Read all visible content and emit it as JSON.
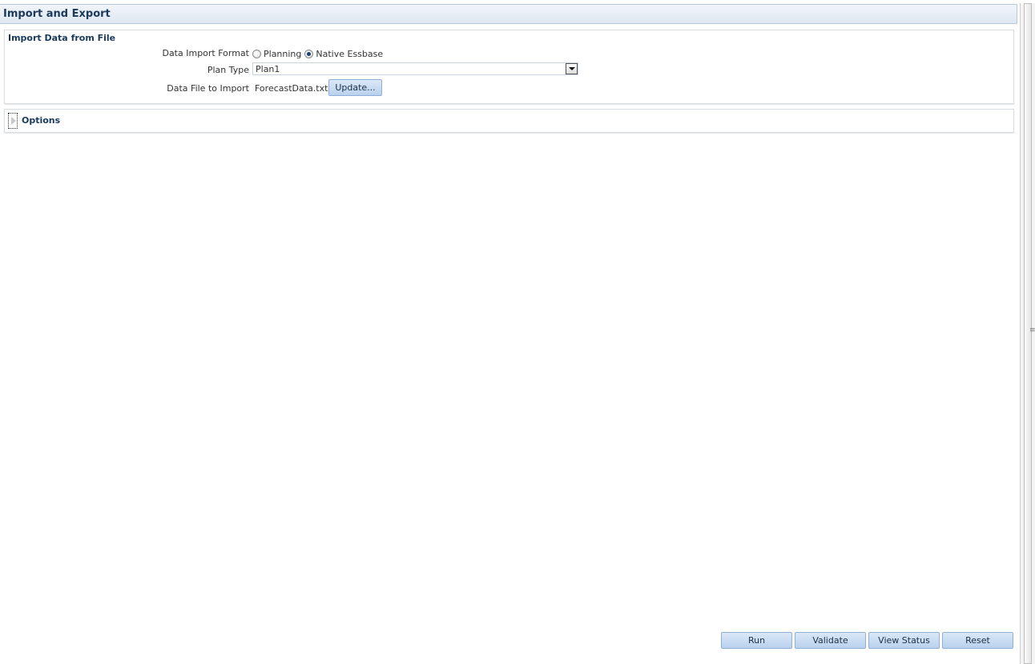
{
  "header": {
    "title": "Import and Export"
  },
  "import_section": {
    "title": "Import Data from File",
    "format_label": "Data Import Format",
    "format_options": [
      {
        "label": "Planning",
        "checked": false
      },
      {
        "label": "Native Essbase",
        "checked": true
      }
    ],
    "plan_type_label": "Plan Type",
    "plan_type_value": "Plan1",
    "file_label": "Data File to Import",
    "file_value": "ForecastData.txt",
    "update_button": "Update..."
  },
  "options_section": {
    "label": "Options",
    "expanded": false
  },
  "actions": {
    "run": "Run",
    "validate": "Validate",
    "view_status": "View Status",
    "reset": "Reset"
  },
  "colors": {
    "title_text": "#1a3a5c",
    "button_fill": "#c9dcf2",
    "button_border": "#8fb0d6"
  },
  "icons": {
    "expand": "expand-triangle-icon",
    "dropdown": "chevron-down-icon",
    "scroll_grip": "grip-icon"
  }
}
